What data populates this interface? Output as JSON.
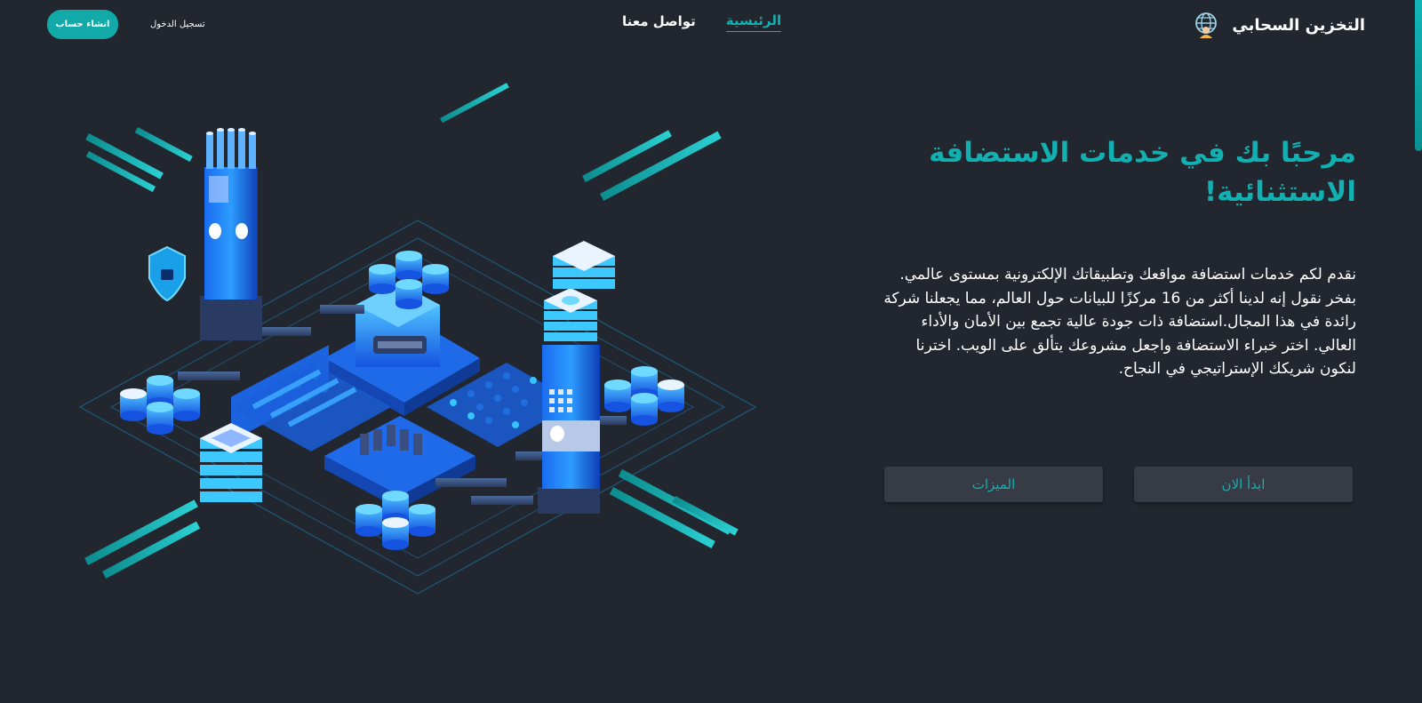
{
  "header": {
    "brand_name": "التخزين السحابي",
    "brand_icon": "globe-user-icon",
    "nav": [
      {
        "label": "الرئيسية",
        "active": true
      },
      {
        "label": "تواصل معنا",
        "active": false
      }
    ],
    "login_label": "تسجيل الدخول",
    "signup_label": "انشاء حساب"
  },
  "hero": {
    "title": "مرحبًا بك في خدمات الاستضافة الاستثنائية!",
    "description": "نقدم لكم خدمات استضافة مواقعك وتطبيقاتك الإلكترونية بمستوى عالمي. بفخر نقول إنه لدينا أكثر من 16 مركزًا للبيانات حول العالم، مما يجعلنا شركة رائدة في هذا المجال.استضافة ذات جودة عالية تجمع بين الأمان والأداء العالي. اختر خبراء الاستضافة واجعل مشروعك يتألق على الويب. اخترنا لنكون شريكك الإستراتيجي في النجاح.",
    "primary_button": "ابدأ الان",
    "secondary_button": "الميزات"
  },
  "illustration": {
    "icon": "datacenter-isometric-illustration"
  },
  "colors": {
    "background": "#21262f",
    "accent": "#13b0b2",
    "button_bg": "#363b45"
  }
}
